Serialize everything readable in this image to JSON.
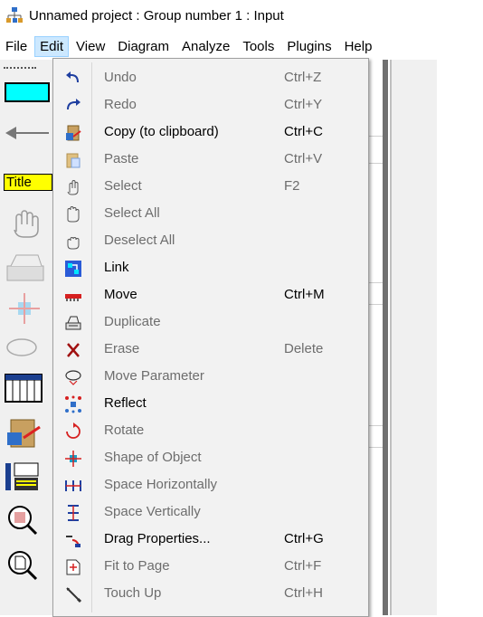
{
  "window": {
    "title": "Unnamed project : Group number 1 : Input"
  },
  "menubar": [
    {
      "label": "File"
    },
    {
      "label": "Edit"
    },
    {
      "label": "View"
    },
    {
      "label": "Diagram"
    },
    {
      "label": "Analyze"
    },
    {
      "label": "Tools"
    },
    {
      "label": "Plugins"
    },
    {
      "label": "Help"
    }
  ],
  "toolbar": {
    "title_tool_label": "Title"
  },
  "edit_menu": {
    "items": [
      {
        "label": "Undo",
        "shortcut": "Ctrl+Z",
        "icon": "undo-icon",
        "enabled": false
      },
      {
        "label": "Redo",
        "shortcut": "Ctrl+Y",
        "icon": "redo-icon",
        "enabled": false
      },
      {
        "label": "Copy (to clipboard)",
        "shortcut": "Ctrl+C",
        "icon": "copy-clipboard-icon",
        "enabled": true
      },
      {
        "label": "Paste",
        "shortcut": "Ctrl+V",
        "icon": "paste-icon",
        "enabled": false
      },
      {
        "label": "Select",
        "shortcut": "F2",
        "icon": "select-hand-icon",
        "enabled": false
      },
      {
        "label": "Select All",
        "shortcut": "",
        "icon": "select-all-hand-icon",
        "enabled": false
      },
      {
        "label": "Deselect All",
        "shortcut": "",
        "icon": "deselect-all-hand-icon",
        "enabled": false
      },
      {
        "label": "Link",
        "shortcut": "",
        "icon": "link-icon",
        "enabled": true
      },
      {
        "label": "Move",
        "shortcut": "Ctrl+M",
        "icon": "move-icon",
        "enabled": true
      },
      {
        "label": "Duplicate",
        "shortcut": "",
        "icon": "duplicate-icon",
        "enabled": false
      },
      {
        "label": "Erase",
        "shortcut": "Delete",
        "icon": "erase-icon",
        "enabled": false
      },
      {
        "label": "Move Parameter",
        "shortcut": "",
        "icon": "move-parameter-icon",
        "enabled": false
      },
      {
        "label": "Reflect",
        "shortcut": "",
        "icon": "reflect-icon",
        "enabled": true
      },
      {
        "label": "Rotate",
        "shortcut": "",
        "icon": "rotate-icon",
        "enabled": false
      },
      {
        "label": "Shape of Object",
        "shortcut": "",
        "icon": "shape-of-object-icon",
        "enabled": false
      },
      {
        "label": "Space Horizontally",
        "shortcut": "",
        "icon": "space-horizontally-icon",
        "enabled": false
      },
      {
        "label": "Space Vertically",
        "shortcut": "",
        "icon": "space-vertically-icon",
        "enabled": false
      },
      {
        "label": "Drag Properties...",
        "shortcut": "Ctrl+G",
        "icon": "drag-properties-icon",
        "enabled": true
      },
      {
        "label": "Fit to Page",
        "shortcut": "Ctrl+F",
        "icon": "fit-to-page-icon",
        "enabled": false
      },
      {
        "label": "Touch Up",
        "shortcut": "Ctrl+H",
        "icon": "touch-up-icon",
        "enabled": false
      }
    ]
  },
  "colors": {
    "accent_selected_menu": "#cce8ff",
    "menu_bg": "#f2f2f2",
    "disabled_text": "#6d6d6d"
  }
}
